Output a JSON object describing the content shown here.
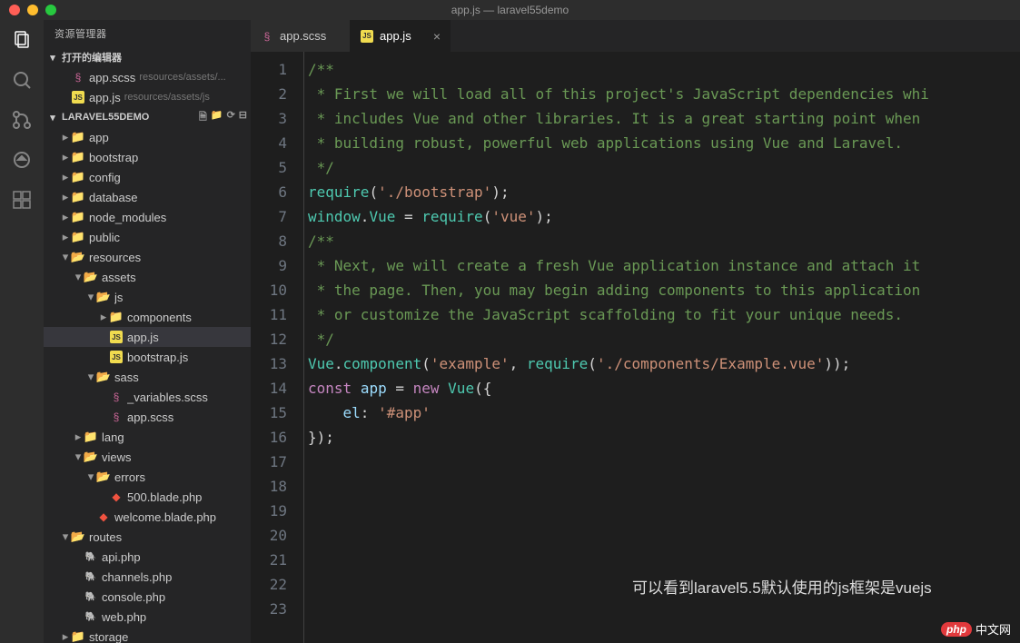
{
  "titlebar": {
    "title": "app.js — laravel55demo"
  },
  "sidebar": {
    "header": "资源管理器",
    "open_editors_label": "打开的编辑器",
    "open_editors": [
      {
        "name": "app.scss",
        "path": "resources/assets/...",
        "icon": "sass"
      },
      {
        "name": "app.js",
        "path": "resources/assets/js",
        "icon": "js"
      }
    ],
    "project_label": "LARAVEL55DEMO",
    "tree": [
      {
        "label": "app",
        "type": "folder",
        "depth": 1,
        "expanded": false
      },
      {
        "label": "bootstrap",
        "type": "folder",
        "depth": 1,
        "expanded": false
      },
      {
        "label": "config",
        "type": "folder",
        "depth": 1,
        "expanded": false,
        "special": true
      },
      {
        "label": "database",
        "type": "folder",
        "depth": 1,
        "expanded": false
      },
      {
        "label": "node_modules",
        "type": "folder",
        "depth": 1,
        "expanded": false,
        "special": true
      },
      {
        "label": "public",
        "type": "folder",
        "depth": 1,
        "expanded": false
      },
      {
        "label": "resources",
        "type": "folder",
        "depth": 1,
        "expanded": true
      },
      {
        "label": "assets",
        "type": "folder",
        "depth": 2,
        "expanded": true
      },
      {
        "label": "js",
        "type": "folder",
        "depth": 3,
        "expanded": true,
        "orange": true
      },
      {
        "label": "components",
        "type": "folder",
        "depth": 4,
        "expanded": false,
        "special": true
      },
      {
        "label": "app.js",
        "type": "file",
        "depth": 4,
        "icon": "js",
        "selected": true
      },
      {
        "label": "bootstrap.js",
        "type": "file",
        "depth": 4,
        "icon": "js"
      },
      {
        "label": "sass",
        "type": "folder",
        "depth": 3,
        "expanded": true,
        "orange": true
      },
      {
        "label": "_variables.scss",
        "type": "file",
        "depth": 4,
        "icon": "sass"
      },
      {
        "label": "app.scss",
        "type": "file",
        "depth": 4,
        "icon": "sass"
      },
      {
        "label": "lang",
        "type": "folder",
        "depth": 2,
        "expanded": false
      },
      {
        "label": "views",
        "type": "folder",
        "depth": 2,
        "expanded": true,
        "orange": true
      },
      {
        "label": "errors",
        "type": "folder",
        "depth": 3,
        "expanded": true
      },
      {
        "label": "500.blade.php",
        "type": "file",
        "depth": 4,
        "icon": "laravel"
      },
      {
        "label": "welcome.blade.php",
        "type": "file",
        "depth": 3,
        "icon": "laravel"
      },
      {
        "label": "routes",
        "type": "folder",
        "depth": 1,
        "expanded": true
      },
      {
        "label": "api.php",
        "type": "file",
        "depth": 2,
        "icon": "php"
      },
      {
        "label": "channels.php",
        "type": "file",
        "depth": 2,
        "icon": "php"
      },
      {
        "label": "console.php",
        "type": "file",
        "depth": 2,
        "icon": "php"
      },
      {
        "label": "web.php",
        "type": "file",
        "depth": 2,
        "icon": "php"
      },
      {
        "label": "storage",
        "type": "folder",
        "depth": 1,
        "expanded": false
      }
    ]
  },
  "tabs": [
    {
      "label": "app.scss",
      "icon": "sass",
      "active": false
    },
    {
      "label": "app.js",
      "icon": "js",
      "active": true
    }
  ],
  "editor": {
    "lines": [
      "",
      "/**",
      " * First we will load all of this project's JavaScript dependencies whi",
      " * includes Vue and other libraries. It is a great starting point when",
      " * building robust, powerful web applications using Vue and Laravel.",
      " */",
      "",
      "require('./bootstrap');",
      "",
      "window.Vue = require('vue');",
      "",
      "/**",
      " * Next, we will create a fresh Vue application instance and attach it",
      " * the page. Then, you may begin adding components to this application",
      " * or customize the JavaScript scaffolding to fit your unique needs.",
      " */",
      "",
      "Vue.component('example', require('./components/Example.vue'));",
      "",
      "const app = new Vue({",
      "    el: '#app'",
      "});",
      ""
    ]
  },
  "overlay": "可以看到laravel5.5默认使用的js框架是vuejs",
  "watermark": {
    "badge": "php",
    "text": "中文网"
  }
}
